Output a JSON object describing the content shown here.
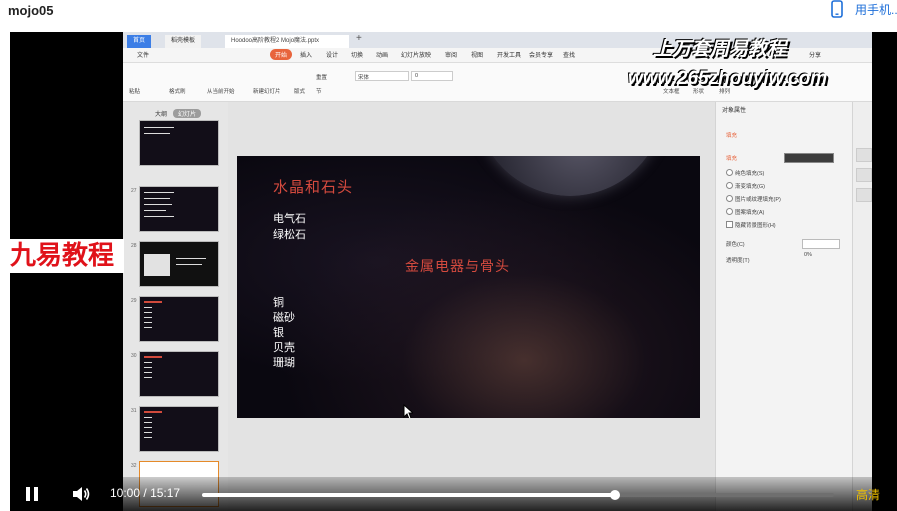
{
  "page": {
    "title": "mojo05",
    "mobile_link": "用手机..."
  },
  "video": {
    "overlay_brand": "上万套周易教程",
    "overlay_url": "www.265zhouyiw.com",
    "watermark_left": "九易教程",
    "current_time": "10:00",
    "separator": "/",
    "duration": "15:17",
    "progress_fraction": 0.654,
    "quality_label": "高清"
  },
  "wps": {
    "tabs": [
      "首页",
      "稻壳模板",
      "Hoodoo高阶教程2 Mojo魔法.pptx"
    ],
    "menu": [
      "文件",
      "开始",
      "插入",
      "设计",
      "切换",
      "动画",
      "幻灯片放映",
      "审阅",
      "视图",
      "开发工具",
      "会员专享",
      "查找"
    ],
    "active_menu": "开始",
    "share": "分享",
    "ribbon": [
      "粘贴",
      "格式刷",
      "从当前开始",
      "新建幻灯片",
      "版式",
      "节",
      "重置",
      "宋体",
      "0",
      "文本框",
      "形状",
      "排列"
    ],
    "outline_tabs": [
      "大纲",
      "幻灯片"
    ],
    "thumb_numbers": [
      "27",
      "28",
      "29",
      "30",
      "31",
      "32"
    ],
    "slide": {
      "title": "水晶和石头",
      "group1": [
        "电气石",
        "绿松石"
      ],
      "middle": "金属电器与骨头",
      "group2": [
        "铜",
        "磁砂",
        "银",
        "贝壳",
        "珊瑚"
      ]
    },
    "right_panel": {
      "title": "对象属性",
      "tab": "填充",
      "section": "填充",
      "options": [
        "纯色填充(S)",
        "渐变填充(G)",
        "图片或纹理填充(P)",
        "图案填充(A)",
        "隐藏背景图形(H)"
      ],
      "color_label": "颜色(C)",
      "transparency_label": "透明度(T)",
      "transparency_value": "0%"
    }
  },
  "colors": {
    "slide_red": "#d44a3e",
    "quality": "#f0c000",
    "watermark": "#e0121a",
    "tab_blue": "#3c7ee6",
    "menu_active": "#e8643c"
  }
}
